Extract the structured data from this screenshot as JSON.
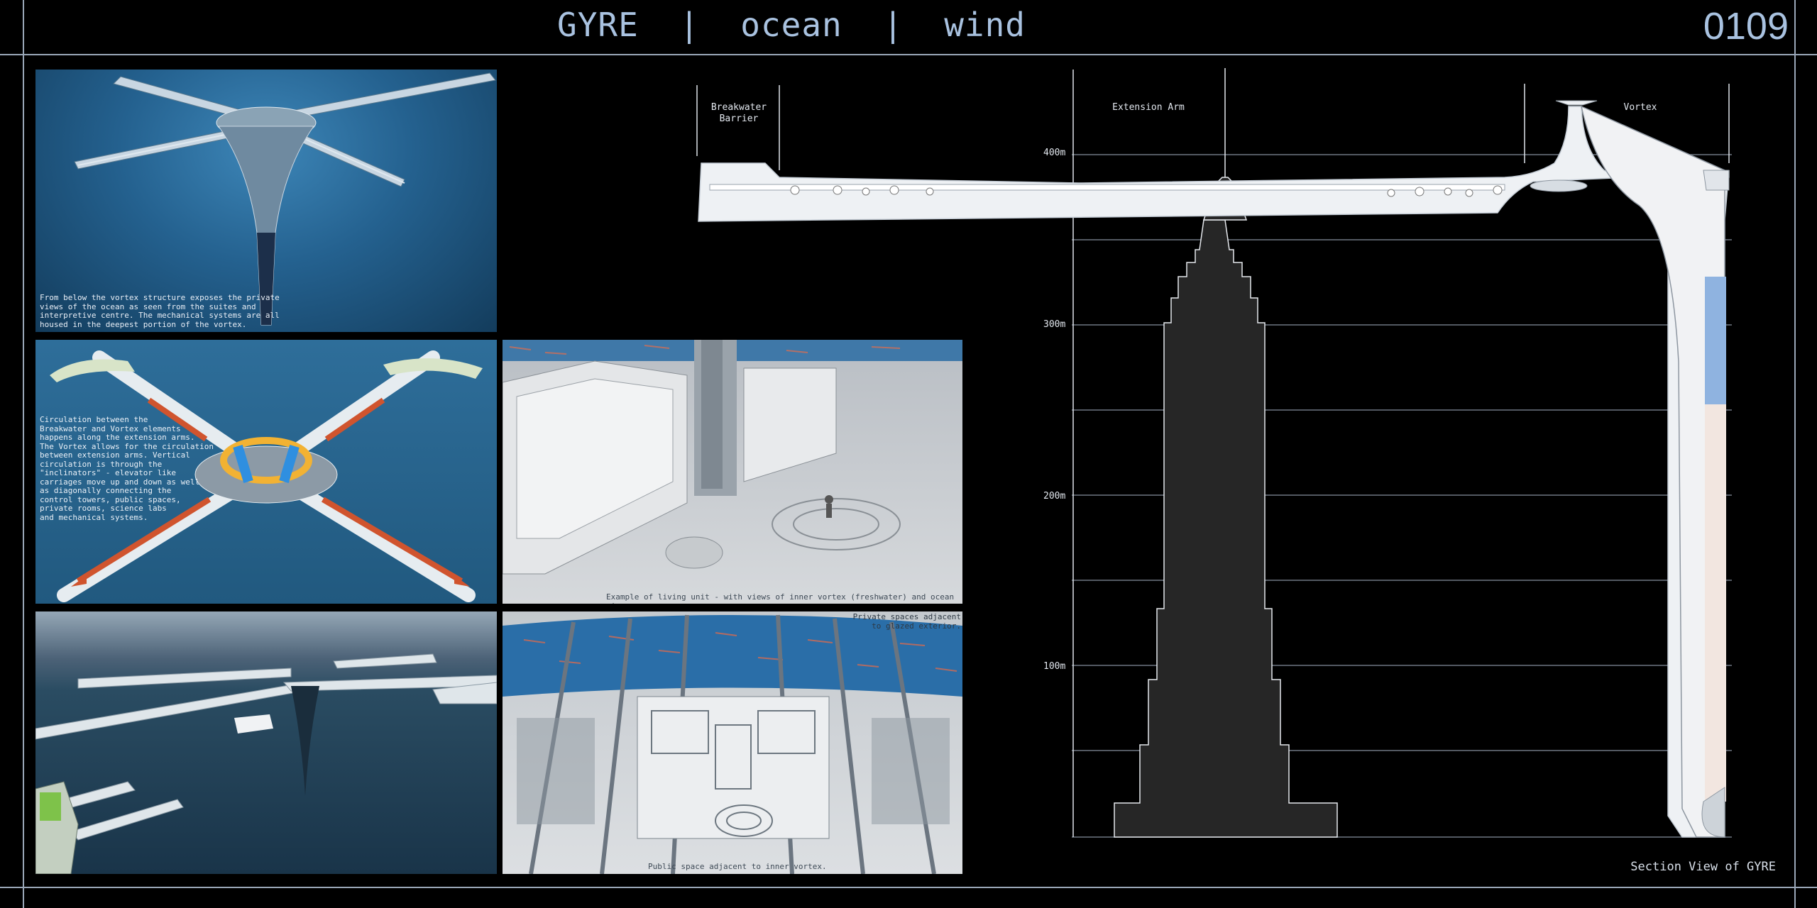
{
  "header": {
    "title": "GYRE  |  ocean  |  wind",
    "sheet_number": "0109"
  },
  "panels": {
    "underwater_view": {
      "caption": "From below the vortex structure exposes the private\nviews of the ocean as seen from the suites and\ninterpretive centre. The mechanical systems are all\nhoused in the deepest portion of the vortex."
    },
    "circulation_view": {
      "caption": "Circulation between the\nBreakwater and Vortex elements\nhappens along the extension arms.\nThe Vortex allows for the circulation\nbetween extension arms. Vertical\ncirculation is through the\n\"inclinators\" - elevator like\ncarriages move up and down as well\nas diagonally connecting the\ncontrol towers, public spaces,\nprivate rooms, science labs\nand mechanical systems."
    },
    "living_unit_view": {
      "caption": "Example of living unit - with views of inner vortex (freshwater) and ocean views"
    },
    "aerial_view": {},
    "public_space_view": {
      "caption_top": "Private spaces adjacent\nto glazed exterior.",
      "caption_bottom": "Public space adjacent to inner vortex."
    }
  },
  "section": {
    "title": "Section View of GYRE",
    "zones": {
      "breakwater": "Breakwater\nBarrier",
      "extension_arm": "Extension Arm",
      "vortex": "Vortex"
    },
    "height_labels": [
      "400m",
      "300m",
      "200m",
      "100m"
    ]
  },
  "colors": {
    "background": "#000000",
    "frame_lines": "#9aa7b8",
    "title_text": "#a9c2e0",
    "ocean_blue": "#2f6f9c",
    "freshwater_blue": "#8fb3e0",
    "building_fill": "#262626"
  }
}
